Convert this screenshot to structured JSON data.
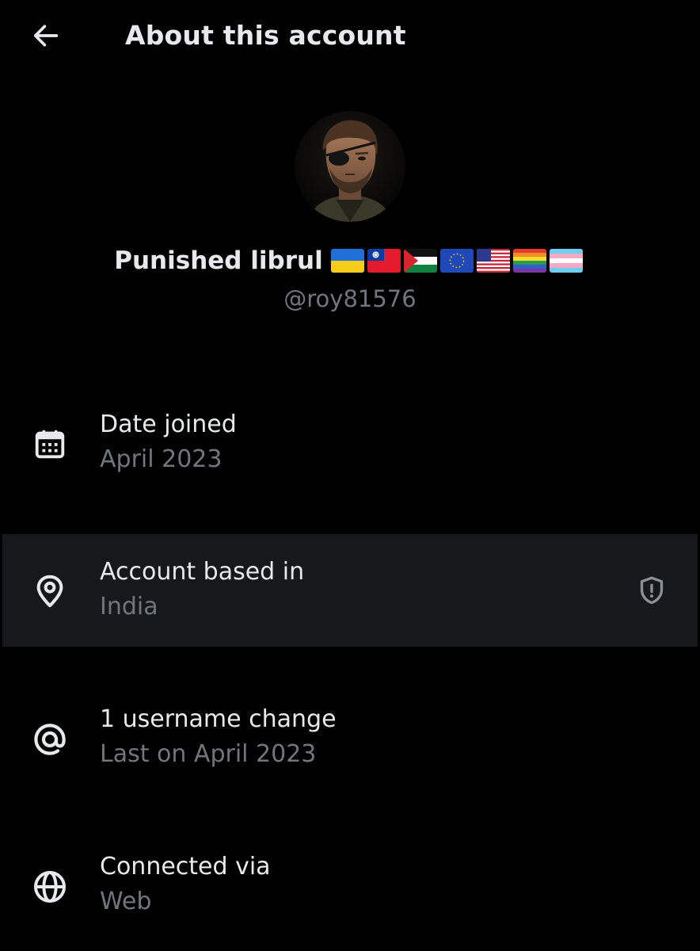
{
  "header": {
    "title": "About this account",
    "back_icon": "arrow-left-icon"
  },
  "profile": {
    "display_name": "Punished librul",
    "flags": [
      "ukraine-flag",
      "taiwan-flag",
      "palestine-flag",
      "eu-flag",
      "usa-flag",
      "rainbow-pride-flag",
      "transgender-pride-flag"
    ],
    "handle": "@roy81576"
  },
  "rows": {
    "date_joined": {
      "label": "Date joined",
      "value": "April 2023",
      "icon": "calendar-icon"
    },
    "based_in": {
      "label": "Account based in",
      "value": "India",
      "icon": "location-pin-icon",
      "action_icon": "shield-alert-icon"
    },
    "username_change": {
      "label": "1 username change",
      "value": "Last on April 2023",
      "icon": "at-sign-icon"
    },
    "connected_via": {
      "label": "Connected via",
      "value": "Web",
      "icon": "globe-icon"
    }
  },
  "colors": {
    "background": "#000000",
    "primary_text": "#e7e9ea",
    "secondary_text": "#71767b",
    "highlight_row": "#16181c"
  }
}
